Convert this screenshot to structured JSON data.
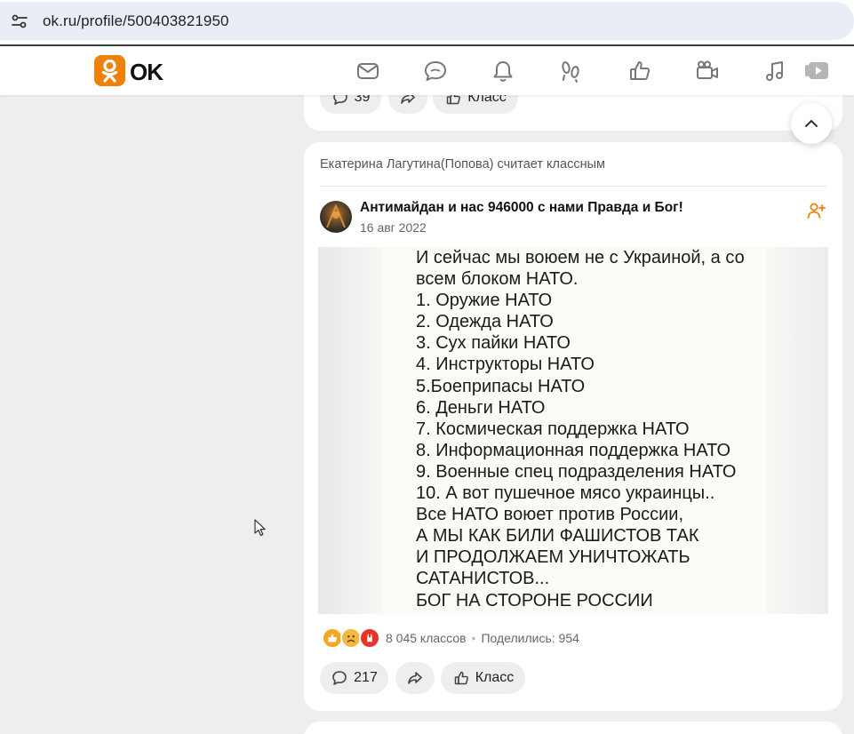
{
  "browser": {
    "url": "ok.ru/profile/500403821950"
  },
  "header": {
    "brand": "OK",
    "nav_icons": [
      "mail-icon",
      "chat-icon",
      "bell-icon",
      "guests-icon",
      "like-icon",
      "video-camera-icon",
      "music-icon",
      "video-play-icon"
    ]
  },
  "prev_post": {
    "comments_count": "39",
    "like_label": "Класс"
  },
  "post": {
    "liked_by_text": "Екатерина Лагутина(Попова) считает классным",
    "group_name": "Антимайдан и нас 946000 с нами Правда и Бог!",
    "date": "16 авг 2022",
    "image_text_lines": [
      "И сейчас мы воюем не с Украиной, а со",
      "всем блоком НАТО.",
      "1. Оружие НАТО",
      "2. Одежда НАТО",
      "3. Сух пайки НАТО",
      "4. Инструкторы НАТО",
      "5.Боеприпасы НАТО",
      "6. Деньги НАТО",
      "7. Космическая поддержка НАТО",
      "8. Информационная поддержка НАТО",
      "9. Военные спец подразделения НАТО",
      "10. А вот пушечное мясо украинцы..",
      "Все НАТО воюет против России,",
      "А МЫ КАК БИЛИ ФАШИСТОВ ТАК",
      "И ПРОДОЛЖАЕМ УНИЧТОЖАТЬ",
      "САТАНИСТОВ...",
      "БОГ НА СТОРОНЕ РОССИИ"
    ],
    "likes_text": "8 045 классов",
    "separator": "•",
    "shares_text": "Поделились: 954",
    "comments_count": "217",
    "like_label": "Класс"
  },
  "colors": {
    "ok_orange": "#ee8208",
    "background": "#eeeeee",
    "card": "#ffffff"
  }
}
